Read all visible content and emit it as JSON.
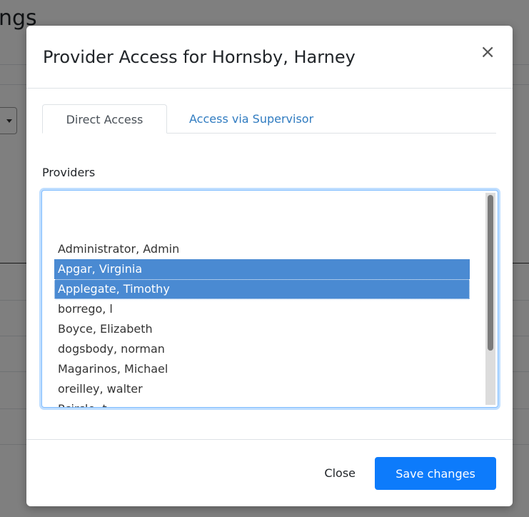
{
  "background": {
    "title_fragment": "ngs"
  },
  "modal": {
    "title": "Provider Access for Hornsby, Harney",
    "close_icon": "×",
    "tabs": [
      {
        "label": "Direct Access",
        "active": true
      },
      {
        "label": "Access via Supervisor",
        "active": false
      }
    ],
    "providers_label": "Providers",
    "providers": [
      {
        "label": "",
        "selected": false
      },
      {
        "label": "",
        "selected": false
      },
      {
        "label": "Administrator, Admin",
        "selected": false
      },
      {
        "label": "Apgar, Virginia",
        "selected": true
      },
      {
        "label": "Applegate, Timothy",
        "selected": true
      },
      {
        "label": "borrego, l",
        "selected": false
      },
      {
        "label": "Boyce, Elizabeth",
        "selected": false
      },
      {
        "label": "dogsbody, norman",
        "selected": false
      },
      {
        "label": "Magarinos, Michael",
        "selected": false
      },
      {
        "label": "oreilley, walter",
        "selected": false
      },
      {
        "label": "Pcircle, t",
        "selected": false
      }
    ],
    "footer": {
      "close_label": "Close",
      "save_label": "Save changes"
    }
  },
  "colors": {
    "primary": "#0d7bfb",
    "selected_option": "#4a8ad2",
    "link": "#2f7bc0"
  }
}
